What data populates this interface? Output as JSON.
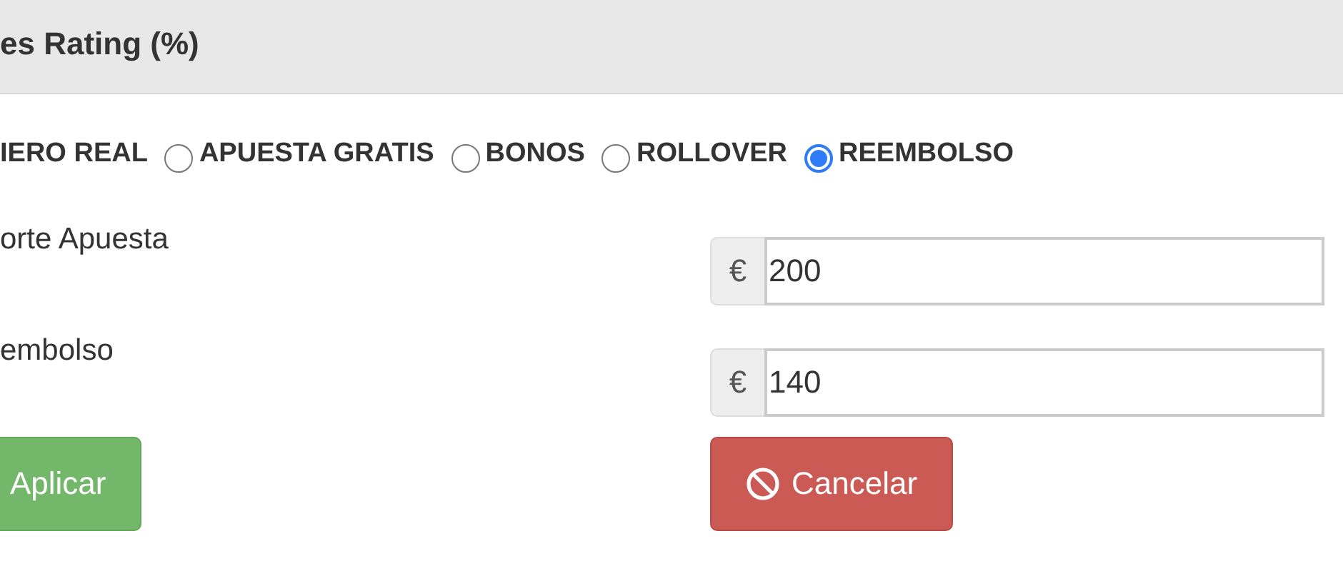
{
  "panel": {
    "title": "es Rating (%)"
  },
  "bet_types": [
    {
      "label": "IERO REAL"
    },
    {
      "label": "APUESTA GRATIS",
      "selected": false
    },
    {
      "label": "BONOS",
      "selected": false
    },
    {
      "label": "ROLLOVER",
      "selected": false
    },
    {
      "label": "REEMBOLSO",
      "selected": true
    }
  ],
  "fields": [
    {
      "label": "orte Apuesta",
      "prefix": "€",
      "value": "200"
    },
    {
      "label": "embolso",
      "prefix": "€",
      "value": "140"
    }
  ],
  "buttons": [
    {
      "kind": "apply",
      "label": "Aplicar"
    },
    {
      "kind": "cancel",
      "label": "Cancelar"
    }
  ]
}
